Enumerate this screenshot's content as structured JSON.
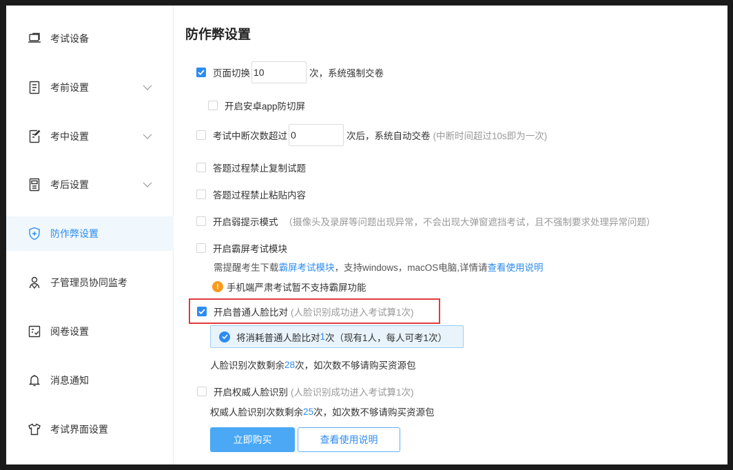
{
  "sidebar": {
    "items": [
      {
        "label": "考试设备",
        "icon": "laptop-icon",
        "expandable": false,
        "active": false
      },
      {
        "label": "考前设置",
        "icon": "document-icon",
        "expandable": true,
        "active": false
      },
      {
        "label": "考中设置",
        "icon": "edit-document-icon",
        "expandable": true,
        "active": false
      },
      {
        "label": "考后设置",
        "icon": "score-document-icon",
        "expandable": true,
        "active": false
      },
      {
        "label": "防作弊设置",
        "icon": "shield-icon",
        "expandable": false,
        "active": true
      },
      {
        "label": "子管理员协同监考",
        "icon": "users-icon",
        "expandable": false,
        "active": false
      },
      {
        "label": "阅卷设置",
        "icon": "grading-icon",
        "expandable": false,
        "active": false
      },
      {
        "label": "消息通知",
        "icon": "bell-icon",
        "expandable": false,
        "active": false
      },
      {
        "label": "考试界面设置",
        "icon": "tshirt-icon",
        "expandable": false,
        "active": false
      }
    ]
  },
  "main": {
    "title": "防作弊设置",
    "page_switch": {
      "checked": true,
      "label": "页面切换",
      "value": "10",
      "suffix": "次，系统强制交卷"
    },
    "android_antiswitch": {
      "checked": false,
      "label": "开启安卓app防切屏"
    },
    "interrupt": {
      "checked": false,
      "label": "考试中断次数超过",
      "value": "0",
      "suffix": "次后，系统自动交卷",
      "hint": "(中断时间超过10s即为一次)"
    },
    "no_copy": {
      "checked": false,
      "label": "答题过程禁止复制试题"
    },
    "no_paste": {
      "checked": false,
      "label": "答题过程禁止粘贴内容"
    },
    "weak_hint": {
      "checked": false,
      "label": "开启弱提示模式",
      "hint": "（摄像头及录屏等问题出现异常，不会出现大弹窗遮挡考试，且不强制要求处理异常问题）"
    },
    "lockdown": {
      "checked": false,
      "label": "开启霸屏考试模块",
      "desc_prefix": "需提醒考生下载",
      "desc_link": "霸屏考试模块",
      "desc_mid": "，支持windows，macOS电脑,详情请",
      "desc_link2": "查看使用说明",
      "warning": "手机端严肃考试暂不支持霸屏功能"
    },
    "face_compare": {
      "checked": true,
      "label": "开启普通人脸比对",
      "hint": "(人脸识别成功进入考试算1次)",
      "info_prefix": "将消耗普通人脸比对",
      "info_count": "1",
      "info_suffix": "次（现有1人，每人可考1次）",
      "remain_prefix": "人脸识别次数剩余",
      "remain_count": "28",
      "remain_suffix": "次，如次数不够请购买资源包"
    },
    "authority_face": {
      "checked": false,
      "label": "开启权威人脸识别",
      "hint": "(人脸识别成功进入考试算1次)",
      "remain_prefix": "权威人脸识别次数剩余",
      "remain_count": "25",
      "remain_suffix": "次，如次数不够请购买资源包"
    },
    "buttons": {
      "buy": "立即购买",
      "guide": "查看使用说明"
    }
  },
  "colors": {
    "accent": "#2d8cf0",
    "highlight_border": "#e03a3a",
    "warning": "#f89b1b"
  }
}
